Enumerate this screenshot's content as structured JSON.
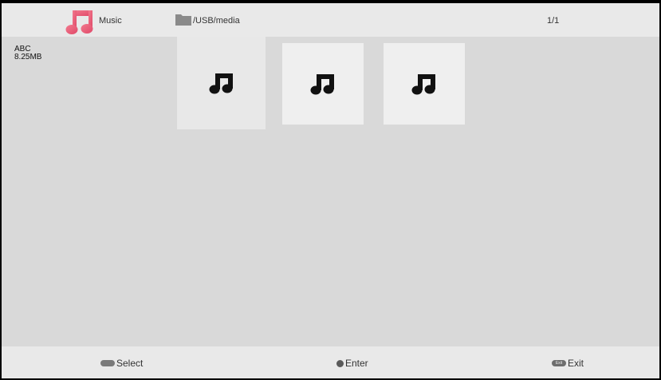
{
  "header": {
    "category_label": "Music",
    "category_icon": "music-note-icon",
    "path": "/USB/media",
    "path_icon": "folder-icon",
    "page_indicator": "1/1"
  },
  "selected_item": {
    "name": "ABC",
    "size": "8.25MB"
  },
  "items": [
    {
      "icon": "music-note-icon",
      "selected": true
    },
    {
      "icon": "music-note-icon",
      "selected": false
    },
    {
      "icon": "music-note-icon",
      "selected": false
    }
  ],
  "footer": {
    "select_label": "Select",
    "enter_label": "Enter",
    "exit_label": "Exit",
    "exit_key_text": "Exit"
  },
  "colors": {
    "accent_pink": "#e45a7a",
    "background": "#d9d9d9",
    "bar": "#e9e9e9"
  }
}
